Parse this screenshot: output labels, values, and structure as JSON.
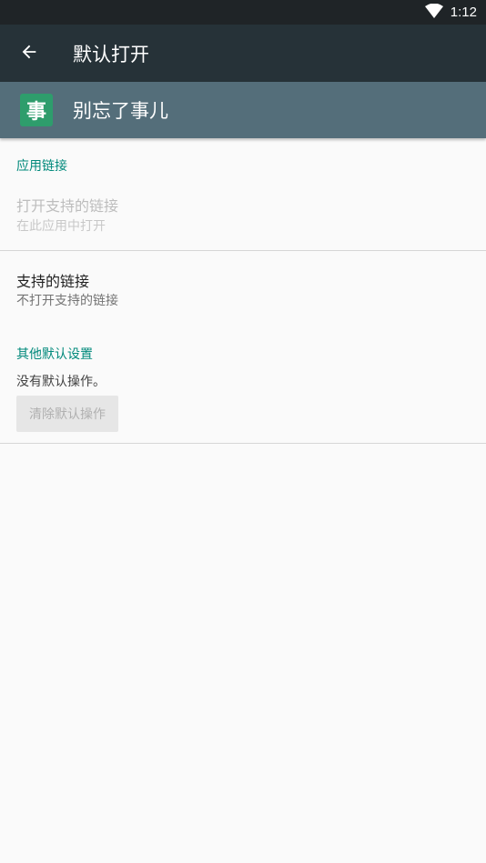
{
  "status_bar": {
    "time": "1:12"
  },
  "toolbar": {
    "title": "默认打开"
  },
  "app_header": {
    "icon_glyph": "事",
    "app_name": "别忘了事儿"
  },
  "app_links_section": {
    "header": "应用链接",
    "open_supported_links": {
      "title": "打开支持的链接",
      "summary": "在此应用中打开"
    },
    "supported_links": {
      "title": "支持的链接",
      "summary": "不打开支持的链接"
    }
  },
  "other_defaults_section": {
    "header": "其他默认设置",
    "no_defaults_text": "没有默认操作。",
    "clear_button_label": "清除默认操作"
  },
  "colors": {
    "status_bar": "#1f2427",
    "toolbar": "#263238",
    "app_header": "#546e7a",
    "accent": "#00897b",
    "app_icon": "#2e9d6c"
  }
}
